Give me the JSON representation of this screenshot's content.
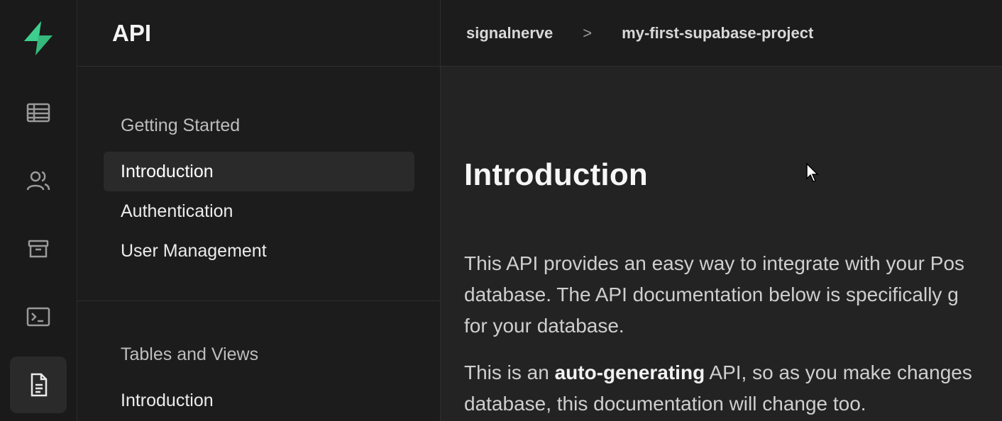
{
  "app": {
    "brand": "supabase",
    "accent": "#3ecf8e"
  },
  "rail": {
    "items": [
      {
        "name": "table-editor",
        "icon": "table-icon"
      },
      {
        "name": "authentication",
        "icon": "users-icon"
      },
      {
        "name": "storage",
        "icon": "archive-icon"
      },
      {
        "name": "sql-editor",
        "icon": "terminal-icon"
      },
      {
        "name": "api-docs",
        "icon": "document-icon",
        "active": true
      }
    ]
  },
  "menu": {
    "title": "API",
    "groups": [
      {
        "title": "Getting Started",
        "items": [
          "Introduction",
          "Authentication",
          "User Management"
        ],
        "active": "Introduction"
      },
      {
        "title": "Tables and Views",
        "items": [
          "Introduction"
        ]
      }
    ]
  },
  "breadcrumb": {
    "org": "signalnerve",
    "separator": ">",
    "project": "my-first-supabase-project"
  },
  "content": {
    "heading": "Introduction",
    "para1_line1": "This API provides an easy way to integrate with your Pos",
    "para1_line2": "database. The API documentation below is specifically g",
    "para1_line3": "for your database.",
    "para2_pre": "This is an ",
    "para2_bold": "auto-generating",
    "para2_post": " API, so as you make changes",
    "para2_line2": "database, this documentation will change too."
  }
}
